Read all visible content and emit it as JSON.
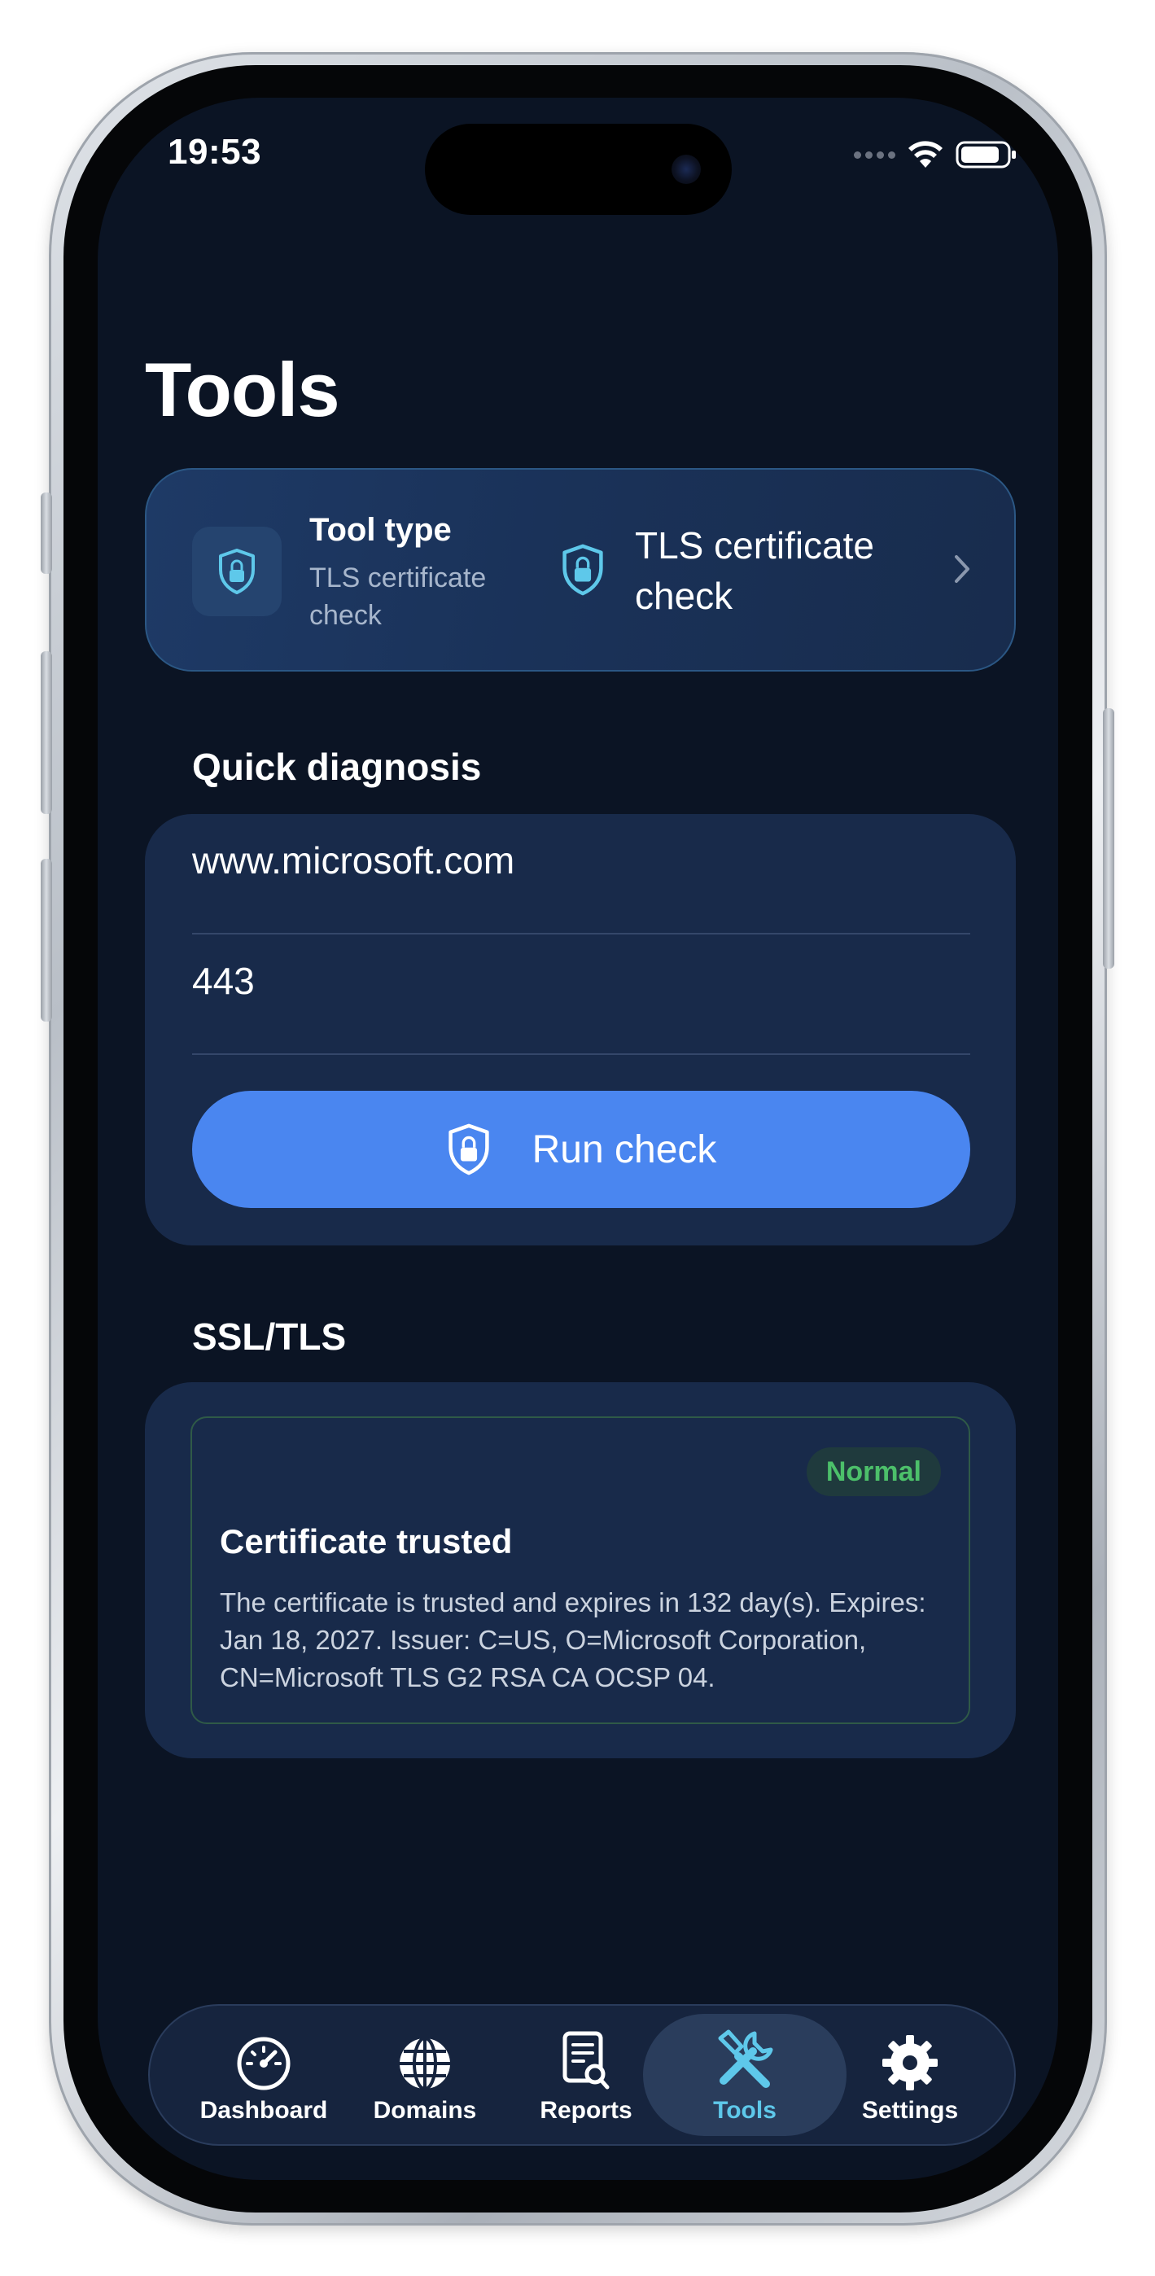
{
  "status_bar": {
    "time": "19:53"
  },
  "page": {
    "title": "Tools"
  },
  "tool_type": {
    "label": "Tool type",
    "subtitle": "TLS certificate check",
    "selected_value": "TLS certificate check",
    "icon": "shield-lock-icon"
  },
  "quick_diagnosis": {
    "title": "Quick diagnosis",
    "host_value": "www.microsoft.com",
    "port_value": "443",
    "run_button_label": "Run check"
  },
  "ssl_tls": {
    "title": "SSL/TLS",
    "status_badge": "Normal",
    "result_title": "Certificate trusted",
    "result_description": "The certificate is trusted and expires in 132 day(s). Expires: Jan 18, 2027. Issuer: C=US, O=Microsoft Corporation, CN=Microsoft TLS G2 RSA CA OCSP 04."
  },
  "tab_bar": {
    "items": [
      {
        "label": "Dashboard",
        "icon": "speedometer-icon"
      },
      {
        "label": "Domains",
        "icon": "globe-icon"
      },
      {
        "label": "Reports",
        "icon": "document-search-icon"
      },
      {
        "label": "Tools",
        "icon": "tools-icon",
        "selected": true
      },
      {
        "label": "Settings",
        "icon": "gear-icon"
      }
    ]
  },
  "colors": {
    "background": "#0b1424",
    "card": "#182a4a",
    "accent": "#4a86f0",
    "accent_cyan": "#5ec8ea",
    "success": "#4cc06a"
  }
}
